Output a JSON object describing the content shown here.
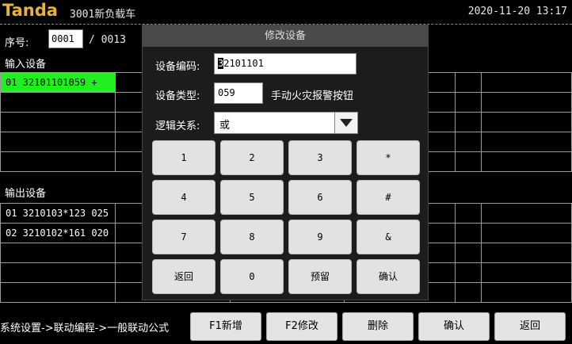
{
  "header": {
    "brand": "Tanda",
    "title": "3001新负载车",
    "datetime": "2020-11-20 13:17"
  },
  "sequence": {
    "label": "序号:",
    "current": "0001",
    "total": "/ 0013"
  },
  "input_section": {
    "title": "输入设备",
    "rows": [
      [
        "01 32101101059 +",
        "",
        "",
        "",
        "",
        ""
      ],
      [
        "",
        "",
        "",
        "",
        "",
        ""
      ],
      [
        "",
        "",
        "",
        "",
        "",
        ""
      ],
      [
        "",
        "",
        "",
        "",
        "",
        ""
      ],
      [
        "",
        "",
        "",
        "",
        "",
        ""
      ]
    ]
  },
  "output_section": {
    "title": "输出设备",
    "rows": [
      [
        "01 3210103*123 025",
        "",
        "",
        "",
        "",
        ""
      ],
      [
        "02 3210102*161 020",
        "",
        "",
        "",
        "",
        ""
      ],
      [
        "",
        "",
        "",
        "",
        "",
        ""
      ],
      [
        "",
        "",
        "",
        "",
        "",
        ""
      ],
      [
        "",
        "",
        "",
        "",
        "",
        ""
      ]
    ]
  },
  "breadcrumb": "系统设置->联动编程->一般联动公式",
  "bottom_buttons": {
    "add": "F1新增",
    "edit": "F2修改",
    "delete": "删除",
    "confirm": "确认",
    "back": "返回"
  },
  "dialog": {
    "title": "修改设备",
    "code_label": "设备编码:",
    "code_caret": "3",
    "code_rest": "2101101",
    "type_label": "设备类型:",
    "type_value": "059",
    "type_description": "手动火灾报警按钮",
    "logic_label": "逻辑关系:",
    "logic_value": "或",
    "keys": {
      "k1": "1",
      "k2": "2",
      "k3": "3",
      "k_star": "*",
      "k4": "4",
      "k5": "5",
      "k6": "6",
      "k_hash": "#",
      "k7": "7",
      "k8": "8",
      "k9": "9",
      "k_amp": "&",
      "k_back": "返回",
      "k0": "0",
      "k_reserve": "预留",
      "k_confirm": "确认"
    }
  },
  "colors": {
    "brand": "#e8b23a",
    "active_cell": "#22ee22",
    "background": "#000000"
  }
}
